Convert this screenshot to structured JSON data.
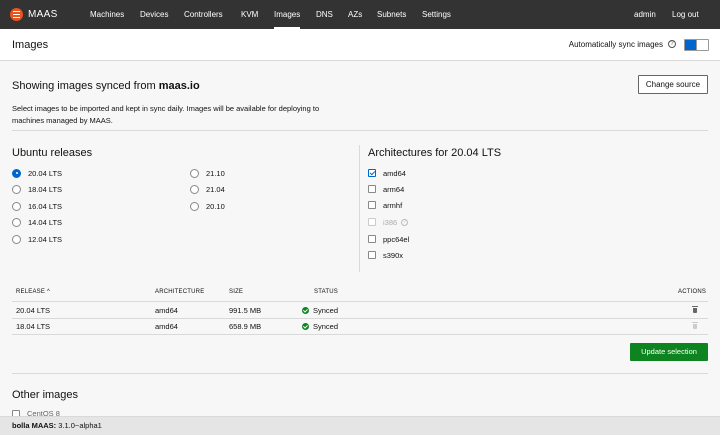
{
  "app": {
    "brand": "MAAS"
  },
  "nav": {
    "items": [
      "Machines",
      "Devices",
      "Controllers",
      "KVM",
      "Images",
      "DNS",
      "AZs",
      "Subnets",
      "Settings"
    ],
    "active": "Images",
    "user": "admin",
    "logout": "Log out"
  },
  "header": {
    "title": "Images",
    "sync_label": "Automatically sync images",
    "sync_enabled": true
  },
  "source": {
    "prefix": "Showing images synced from ",
    "name": "maas.io",
    "change_button": "Change source",
    "description": "Select images to be imported and kept in sync daily. Images will be available for deploying to machines managed by MAAS."
  },
  "ubuntu": {
    "title": "Ubuntu releases",
    "selected": "20.04 LTS",
    "col1": [
      "20.04 LTS",
      "18.04 LTS",
      "16.04 LTS",
      "14.04 LTS",
      "12.04 LTS"
    ],
    "col2": [
      "21.10",
      "21.04",
      "20.10"
    ]
  },
  "architectures": {
    "title": "Architectures for 20.04 LTS",
    "items": [
      {
        "label": "amd64",
        "checked": true,
        "disabled": false
      },
      {
        "label": "arm64",
        "checked": false,
        "disabled": false
      },
      {
        "label": "armhf",
        "checked": false,
        "disabled": false
      },
      {
        "label": "i386",
        "checked": false,
        "disabled": true
      },
      {
        "label": "ppc64el",
        "checked": false,
        "disabled": false
      },
      {
        "label": "s390x",
        "checked": false,
        "disabled": false
      }
    ]
  },
  "table": {
    "headers": {
      "release": "RELEASE",
      "architecture": "ARCHITECTURE",
      "size": "SIZE",
      "status": "STATUS",
      "actions": "ACTIONS"
    },
    "sort_indicator": "^",
    "rows": [
      {
        "release": "20.04 LTS",
        "architecture": "amd64",
        "size": "991.5 MB",
        "status": "Synced"
      },
      {
        "release": "18.04 LTS",
        "architecture": "amd64",
        "size": "658.9 MB",
        "status": "Synced"
      }
    ]
  },
  "update_button": "Update selection",
  "other_images": {
    "title": "Other images",
    "first_item": "CentOS 8"
  },
  "footer": {
    "host": "bolla MAAS:",
    "version": " 3.1.0~alpha1"
  }
}
